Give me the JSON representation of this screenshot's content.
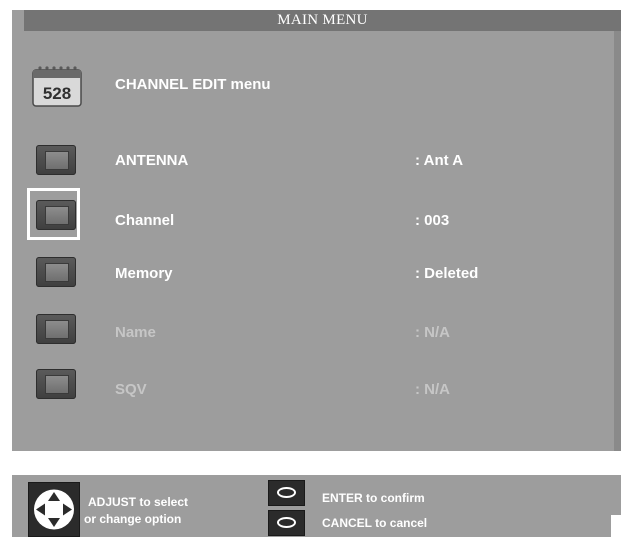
{
  "window": {
    "title": "MAIN MENU"
  },
  "header": {
    "title": "CHANNEL EDIT menu",
    "icon_text": "528",
    "icon": "calendar-icon"
  },
  "rows": [
    {
      "label": "ANTENNA",
      "value": ": Ant A",
      "enabled": true
    },
    {
      "label": "Channel",
      "value": ": 003",
      "enabled": true,
      "selected": true
    },
    {
      "label": "Memory",
      "value": ": Deleted",
      "enabled": true
    },
    {
      "label": "Name",
      "value": ": N/A",
      "enabled": false
    },
    {
      "label": "SQV",
      "value": ": N/A",
      "enabled": false
    }
  ],
  "footer": {
    "adjust_line1": "ADJUST to select",
    "adjust_line2": "or change option",
    "enter_label": "ENTER to confirm",
    "cancel_label": "CANCEL to cancel"
  },
  "colors": {
    "panel": "#9d9d9d",
    "title_bar": "#747474",
    "text": "#ffffff",
    "text_dim": "#c6c6c6"
  }
}
